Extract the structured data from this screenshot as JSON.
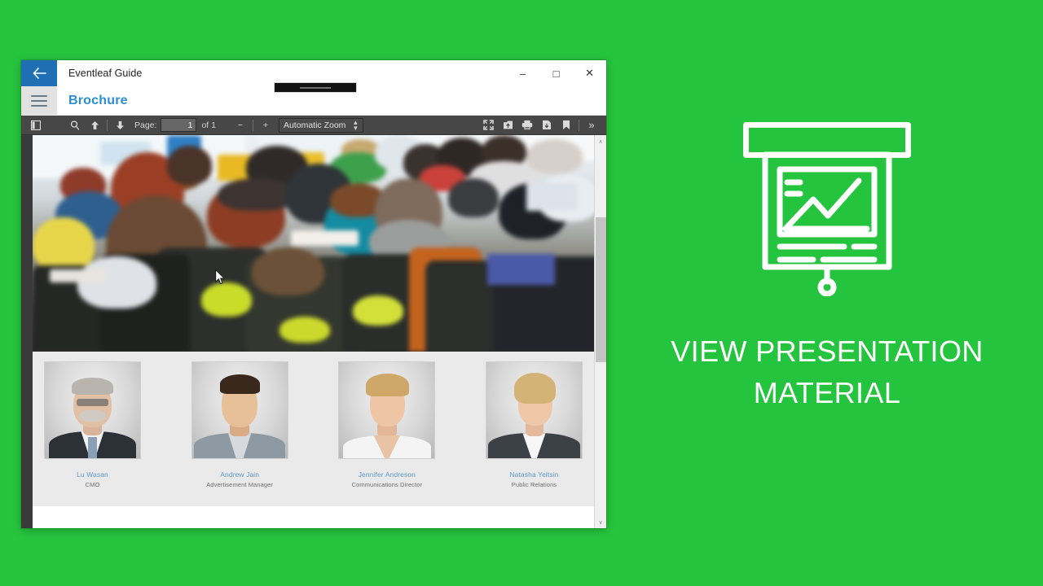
{
  "theme": {
    "background_green": "#25C43E",
    "accent_blue": "#2A8FD0",
    "back_button_blue": "#1F6FB5",
    "toolbar_dark": "#474747",
    "gutter_dark": "#3A3A3A",
    "name_blue": "#5F9AC8"
  },
  "window": {
    "titlebar": {
      "back_icon": "back-arrow-icon",
      "title": "Eventleaf Guide",
      "minimize_label": "–",
      "maximize_label": "□",
      "close_label": "✕"
    },
    "app_header": {
      "menu_icon": "hamburger-menu-icon",
      "title": "Brochure"
    },
    "pdf_toolbar": {
      "sidebar_toggle_icon": "sidebar-toggle-icon",
      "find_icon": "search-icon",
      "previous_page_icon": "arrow-up-icon",
      "next_page_icon": "arrow-down-icon",
      "page_label": "Page:",
      "page_value": "1",
      "page_total": "of 1",
      "zoom_out_label": "−",
      "zoom_in_label": "+",
      "zoom_value": "Automatic Zoom",
      "zoom_caret": "⬍",
      "presentation_mode_icon": "fullscreen-presentation-icon",
      "open_file_icon": "open-file-icon",
      "print_icon": "print-icon",
      "download_icon": "download-icon",
      "bookmark_icon": "bookmark-icon",
      "more_tools_label": "»"
    },
    "scrollbar": {
      "up_arrow": "∧",
      "down_arrow": "∨"
    }
  },
  "document": {
    "hero_image_alt": "seminar-audience-photo",
    "team": [
      {
        "name": "Lu Wasan",
        "title": "CMO"
      },
      {
        "name": "Andrew Jain",
        "title": "Advertisement Manager"
      },
      {
        "name": "Jennifer Andreson",
        "title": "Communications Director"
      },
      {
        "name": "Natasha Yeltsin",
        "title": "Public Relations"
      }
    ]
  },
  "promo": {
    "icon": "presentation-screen-chart-icon",
    "line1": "VIEW PRESENTATION",
    "line2": "MATERIAL"
  }
}
